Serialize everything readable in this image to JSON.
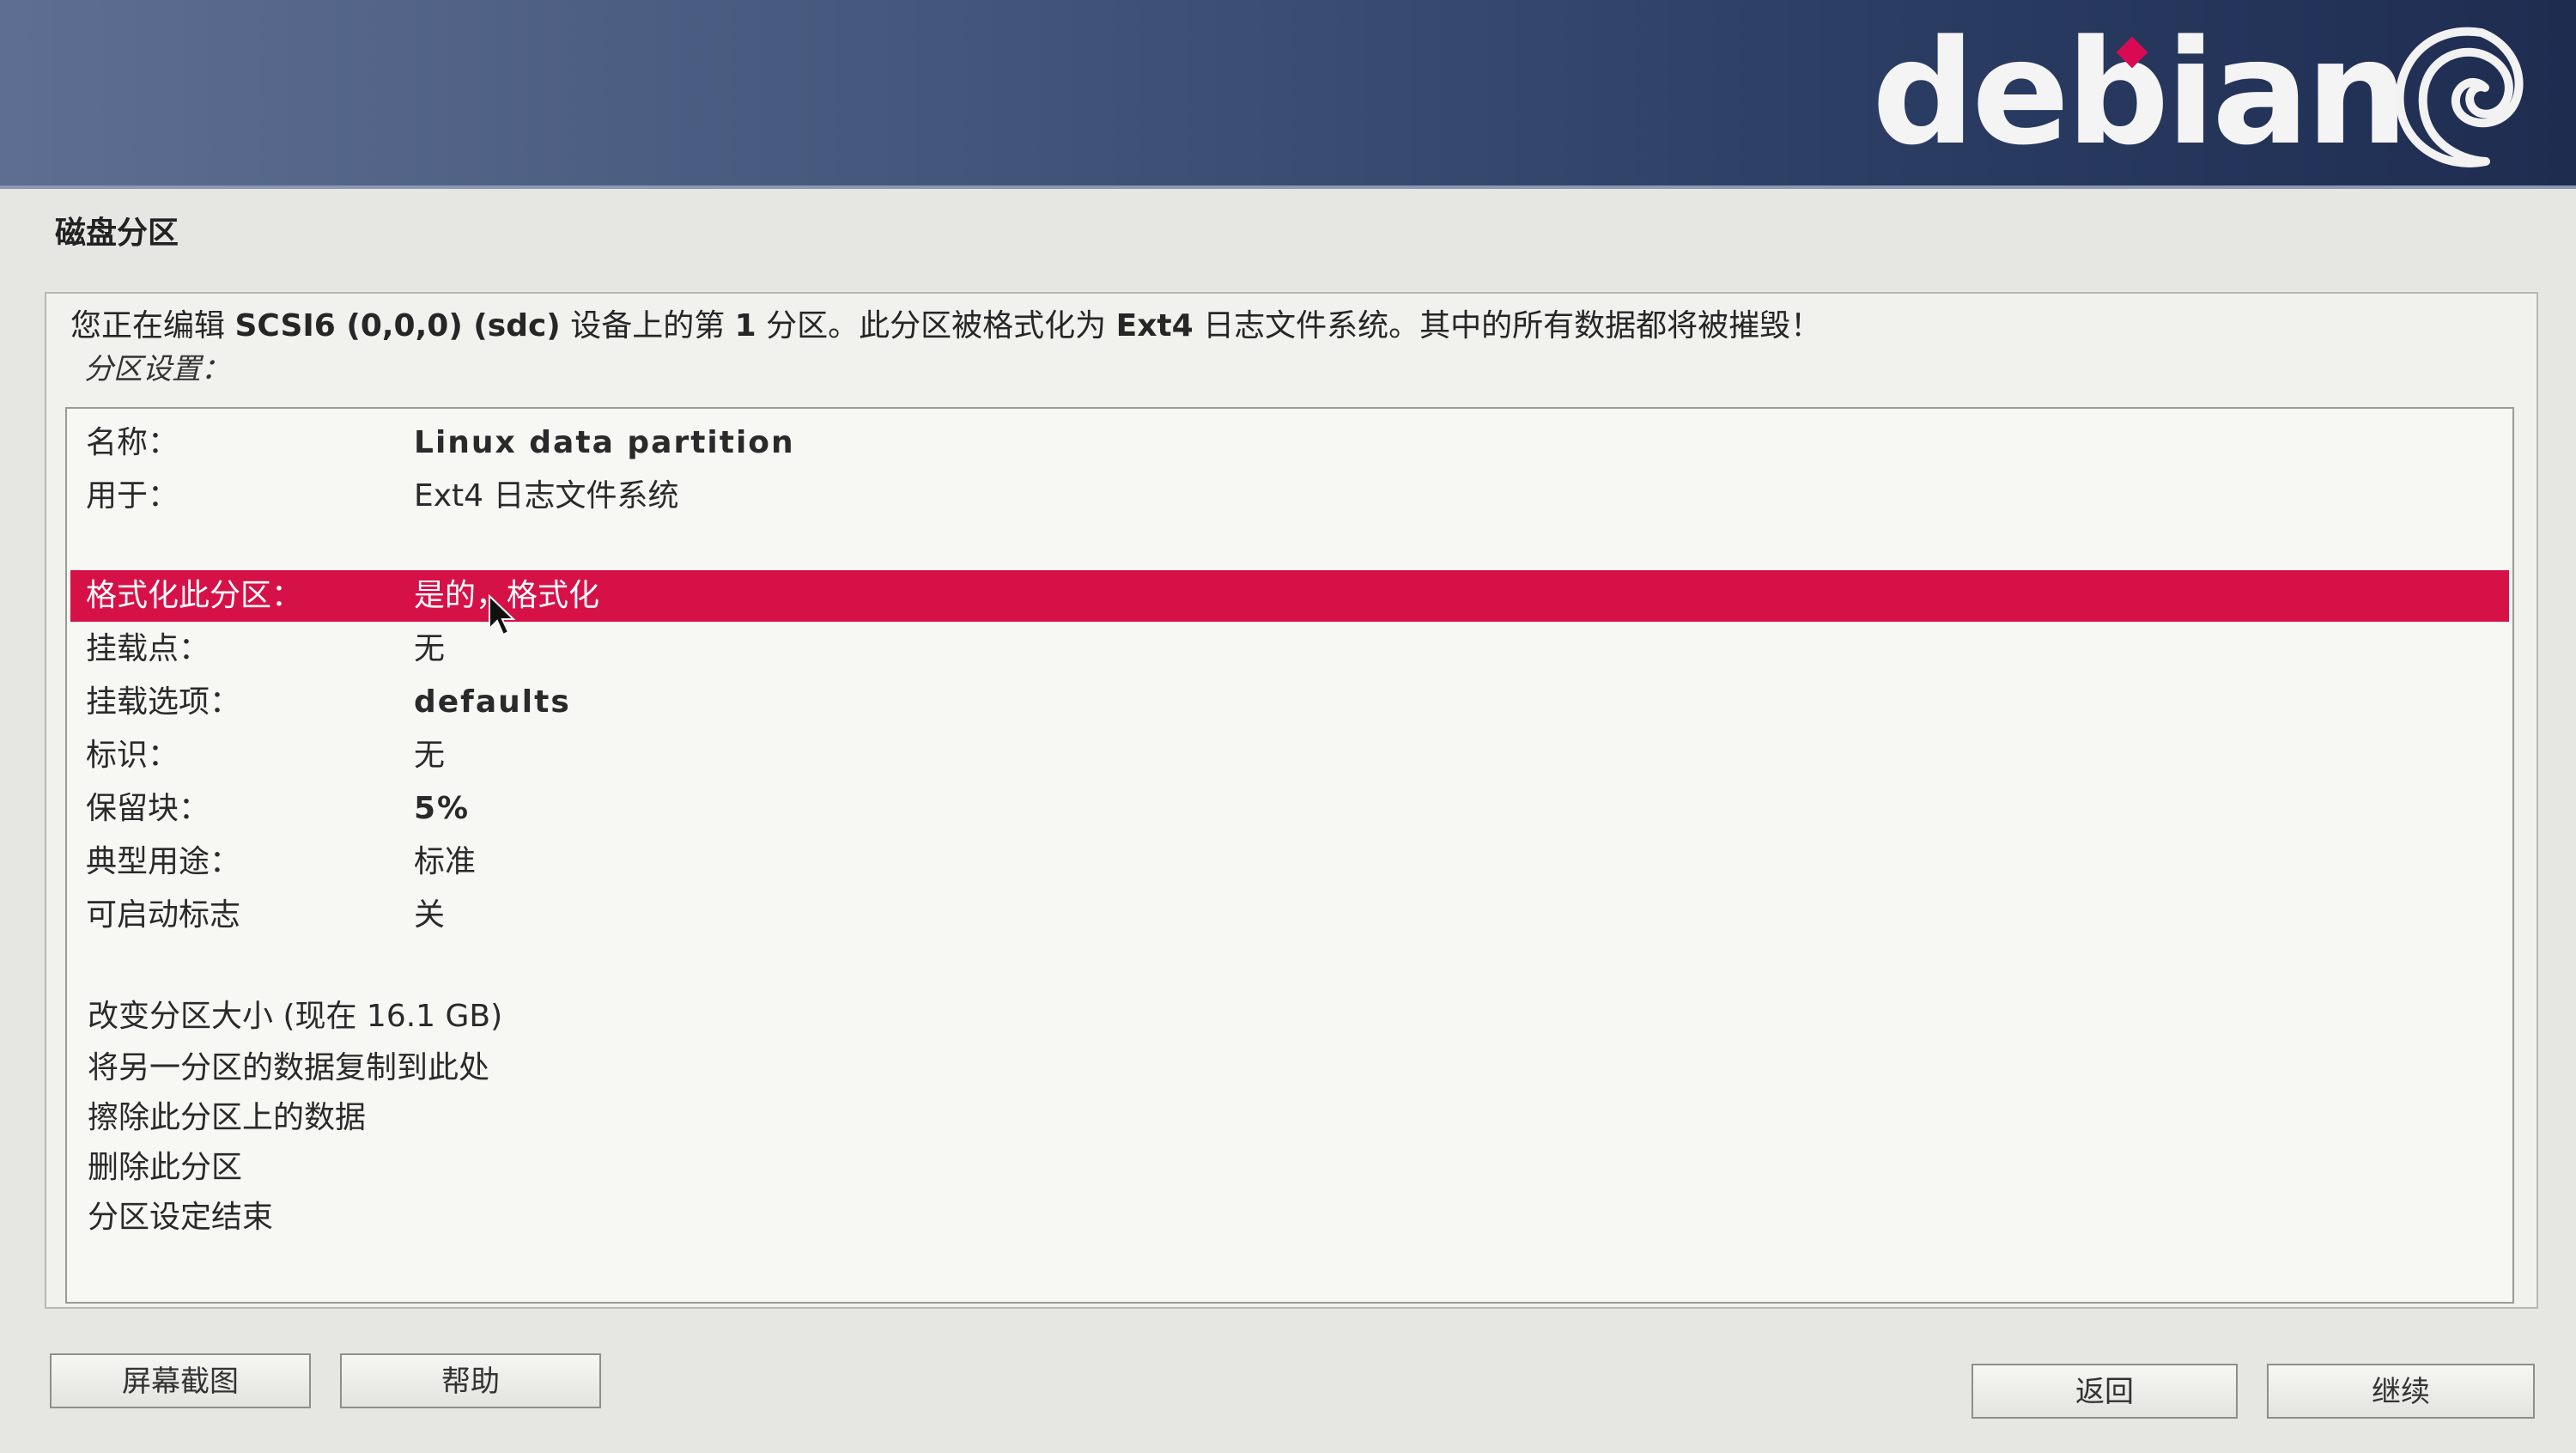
{
  "header": {
    "logo_text": "debian",
    "brand_color": "#d70a53"
  },
  "page_title": "磁盘分区",
  "intro": {
    "prefix": "您正在编辑 ",
    "device": "SCSI6 (0,0,0) (sdc)",
    "middle": " 设备上的第 ",
    "number": "1",
    "middle2": " 分区。此分区被格式化为 ",
    "fs": "Ext4",
    "suffix": " 日志文件系统。其中的所有数据都将被摧毁！"
  },
  "settings_label": "分区设置：",
  "settings": [
    {
      "label": "名称：",
      "value": "Linux data partition",
      "strong": true
    },
    {
      "label": "用于：",
      "value": "Ext4 日志文件系统",
      "strong": false
    },
    {
      "label": "格式化此分区：",
      "value": "是的，格式化",
      "strong": false,
      "selected": true
    },
    {
      "label": "挂载点：",
      "value": "无",
      "strong": false
    },
    {
      "label": "挂载选项：",
      "value": "defaults",
      "strong": true
    },
    {
      "label": "标识：",
      "value": "无",
      "strong": false
    },
    {
      "label": "保留块：",
      "value": "5%",
      "strong": true
    },
    {
      "label": "典型用途：",
      "value": "标准",
      "strong": false
    },
    {
      "label": "可启动标志",
      "value": "关",
      "strong": false
    }
  ],
  "actions": [
    "改变分区大小 (现在 16.1 GB)",
    "将另一分区的数据复制到此处",
    "擦除此分区上的数据",
    "删除此分区",
    "分区设定结束"
  ],
  "buttons": {
    "screenshot": "屏幕截图",
    "help": "帮助",
    "back": "返回",
    "continue": "继续"
  },
  "colors": {
    "selection": "#d51148",
    "header_dark": "#1e2c50"
  }
}
